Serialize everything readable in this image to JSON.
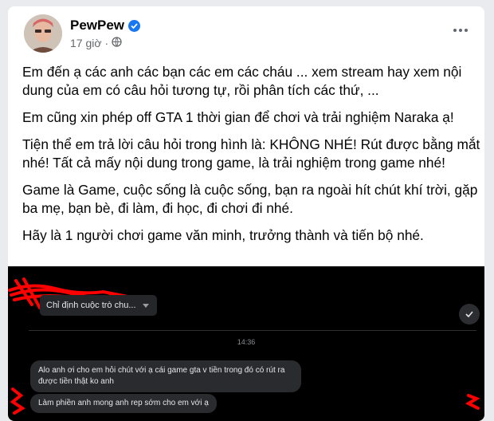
{
  "post": {
    "author": "PewPew",
    "time": "17 giờ",
    "paragraphs": [
      "Em đến ạ các anh các bạn các em các cháu ... xem stream hay xem nội dung của em có câu hỏi tương tự, rồi phân tích các thứ, ...",
      "Em cũng xin phép off GTA 1 thời gian để chơi và trải nghiệm Naraka ạ!",
      "Tiện thể em trả lời câu hỏi trong hình là: KHÔNG NHÉ! Rút được bằng mắt nhé! Tất cả mấy nội dung trong game, là trải nghiệm trong game nhé!",
      "Game là Game, cuộc sống là cuộc sống, bạn ra ngoài hít chút khí trời, gặp ba mẹ, bạn bè, đi làm, đi học, đi chơi đi nhé.",
      "Hãy là 1 người chơi game văn minh, trưởng thành và tiến bộ nhé."
    ]
  },
  "screenshot": {
    "group_label": "Chỉ định cuộc trò chu...",
    "time_divider": "14:36",
    "messages": [
      "Alo anh ơi cho em hỏi chút với ạ cái game gta v tiền trong đó có rút ra được tiền thật ko anh",
      "Làm phiền anh mong anh rep sớm cho em với ạ"
    ]
  },
  "icons": {
    "verified": "verified-badge-icon",
    "audience": "globe-icon",
    "more": "more-options-icon",
    "check": "check-icon"
  },
  "colors": {
    "accent": "#1877f2",
    "redaction": "#ff0000",
    "photo_bg": "#000000"
  }
}
